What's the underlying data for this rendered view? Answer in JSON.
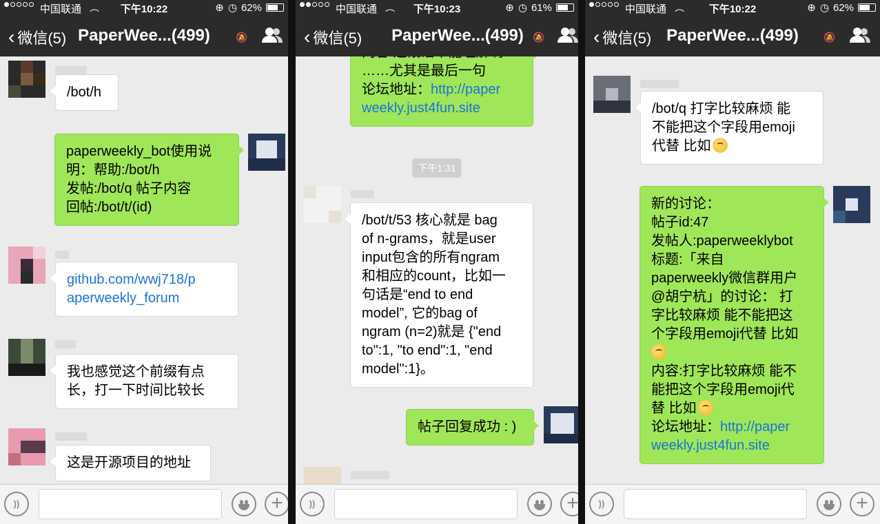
{
  "status": {
    "carrier": "中国联通",
    "battery1": "62%",
    "battery2": "61%",
    "battery3": "62%",
    "time1": "下午10:22",
    "time2": "下午10:23",
    "time3": "下午10:22"
  },
  "nav": {
    "back_label": "微信(5)",
    "title": "PaperWee...(499)"
  },
  "p1": {
    "m1": "/bot/h",
    "m2": [
      "paperweekly_bot使用说",
      "明：帮助:/bot/h",
      "发帖:/bot/q 帖子内容",
      "回帖:/bot/t/(id)"
    ],
    "m3": [
      "github.com/wwj718/p",
      "aperweekly_forum"
    ],
    "m4": [
      "我也感觉这个前缀有点",
      "长，打一下时间比较长"
    ],
    "m5": "这是开源项目的地址"
  },
  "p2": {
    "m1": [
      "内容:这段话不能理解啊",
      "……尤其是最后一句",
      "论坛地址："
    ],
    "m1_link": [
      "http://paper",
      "weekly.just4fun.site"
    ],
    "timestamp": "下午1:31",
    "m2": [
      "/bot/t/53 核心就是 bag",
      "of n-grams，就是user",
      "input包含的所有ngram",
      "和相应的count，比如一",
      "句话是“end to end",
      "model”, 它的bag of",
      "ngram (n=2)就是 {\"end",
      "to\":1, \"to end\":1, \"end",
      "model\":1}。"
    ],
    "m3": "帖子回复成功 : )"
  },
  "p3": {
    "m1": [
      "/bot/q 打字比较麻烦 能",
      "不能把这个字段用emoji",
      "代替 比如"
    ],
    "m2": [
      "新的讨论：",
      "帖子id:47",
      "发帖人:paperweeklybot",
      "标题:「来自",
      "paperweekly微信群用户",
      "@胡宁杭」的讨论： 打",
      "字比较麻烦 能不能把这",
      "个字段用emoji代替 比如",
      "",
      "内容:打字比较麻烦 能不",
      "能把这个字段用emoji代",
      "替 比如",
      "论坛地址："
    ],
    "m2_link": [
      "http://paper",
      "weekly.just4fun.site"
    ]
  },
  "colors": {
    "bubble_green": "#9fe658",
    "bubble_white": "#ffffff",
    "nav_bg": "#2b2b2b",
    "chat_bg": "#ebebeb",
    "link": "#1a73d9"
  },
  "icons": [
    "back-chevron-icon",
    "mute-icon",
    "group-members-icon",
    "voice-icon",
    "emoji-icon",
    "plus-icon",
    "wifi-icon",
    "battery-icon",
    "rotation-lock-icon",
    "alarm-icon"
  ]
}
